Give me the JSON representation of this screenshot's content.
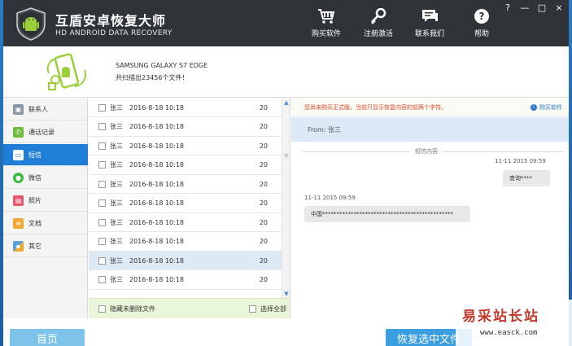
{
  "app": {
    "title": "互盾安卓恢复大师",
    "subtitle": "HD ANDROID DATA RECOVERY",
    "window_controls": [
      "?",
      "—",
      "□",
      "×"
    ]
  },
  "toolbar": [
    {
      "label": "购买软件",
      "icon": "cart-icon"
    },
    {
      "label": "注册激活",
      "icon": "key-icon"
    },
    {
      "label": "联系我们",
      "icon": "chat-icon"
    },
    {
      "label": "帮助",
      "icon": "help-icon"
    }
  ],
  "device": {
    "name": "SAMSUNG GALAXY S7 EDGE",
    "count_text": "共扫描出23456个文件！"
  },
  "sidebar": [
    {
      "label": "联系人",
      "icon": "contacts-icon",
      "color": "#8a96a8",
      "active": false
    },
    {
      "label": "通话记录",
      "icon": "phone-icon",
      "color": "#6ebb3c",
      "active": false
    },
    {
      "label": "短信",
      "icon": "sms-icon",
      "color": "#ffffff",
      "active": true
    },
    {
      "label": "微信",
      "icon": "wechat-icon",
      "color": "#3fb93f",
      "active": false
    },
    {
      "label": "照片",
      "icon": "photo-icon",
      "color": "#e8566c",
      "active": false
    },
    {
      "label": "文档",
      "icon": "document-icon",
      "color": "#f0a830",
      "active": false
    },
    {
      "label": "其它",
      "icon": "other-icon",
      "color": "#5aa0e0",
      "active": false
    }
  ],
  "messages": [
    {
      "name": "张三",
      "date": "2016-8-18 10:18",
      "count": "20"
    },
    {
      "name": "张三",
      "date": "2016-8-18 10:18",
      "count": "20"
    },
    {
      "name": "张三",
      "date": "2016-8-18 10:18",
      "count": "20"
    },
    {
      "name": "张三",
      "date": "2016-8-18 10:18",
      "count": "20"
    },
    {
      "name": "张三",
      "date": "2016-8-18 10:18",
      "count": "20"
    },
    {
      "name": "张三",
      "date": "2016-8-18 10:18",
      "count": "20"
    },
    {
      "name": "张三",
      "date": "2016-8-18 10:18",
      "count": "20"
    },
    {
      "name": "张三",
      "date": "2016-8-18 10:18",
      "count": "20"
    },
    {
      "name": "张三",
      "date": "2016-8-18 10:18",
      "count": "20"
    },
    {
      "name": "张三",
      "date": "2016-8-18 10:18",
      "count": "20"
    }
  ],
  "selected_row": 8,
  "list_footer": {
    "hide_label": "隐藏未删除文件",
    "select_all_label": "选择全部"
  },
  "detail": {
    "notice": "您尚未购买正式版，当前只显示恢复内容的前两个字符。",
    "buy_link": "购买软件",
    "from": "From: 张三",
    "section_label": "短信内容",
    "msg1_time": "11-11 2015 09:59",
    "msg1_text": "查询****",
    "msg2_time": "11-11 2015 09:59",
    "msg2_text": "中国**********************************************"
  },
  "bottom": {
    "home_label": "首页",
    "recover_label": "恢复选中文件"
  },
  "watermark": {
    "text": "易采站长站",
    "url": "www.easck.com"
  }
}
